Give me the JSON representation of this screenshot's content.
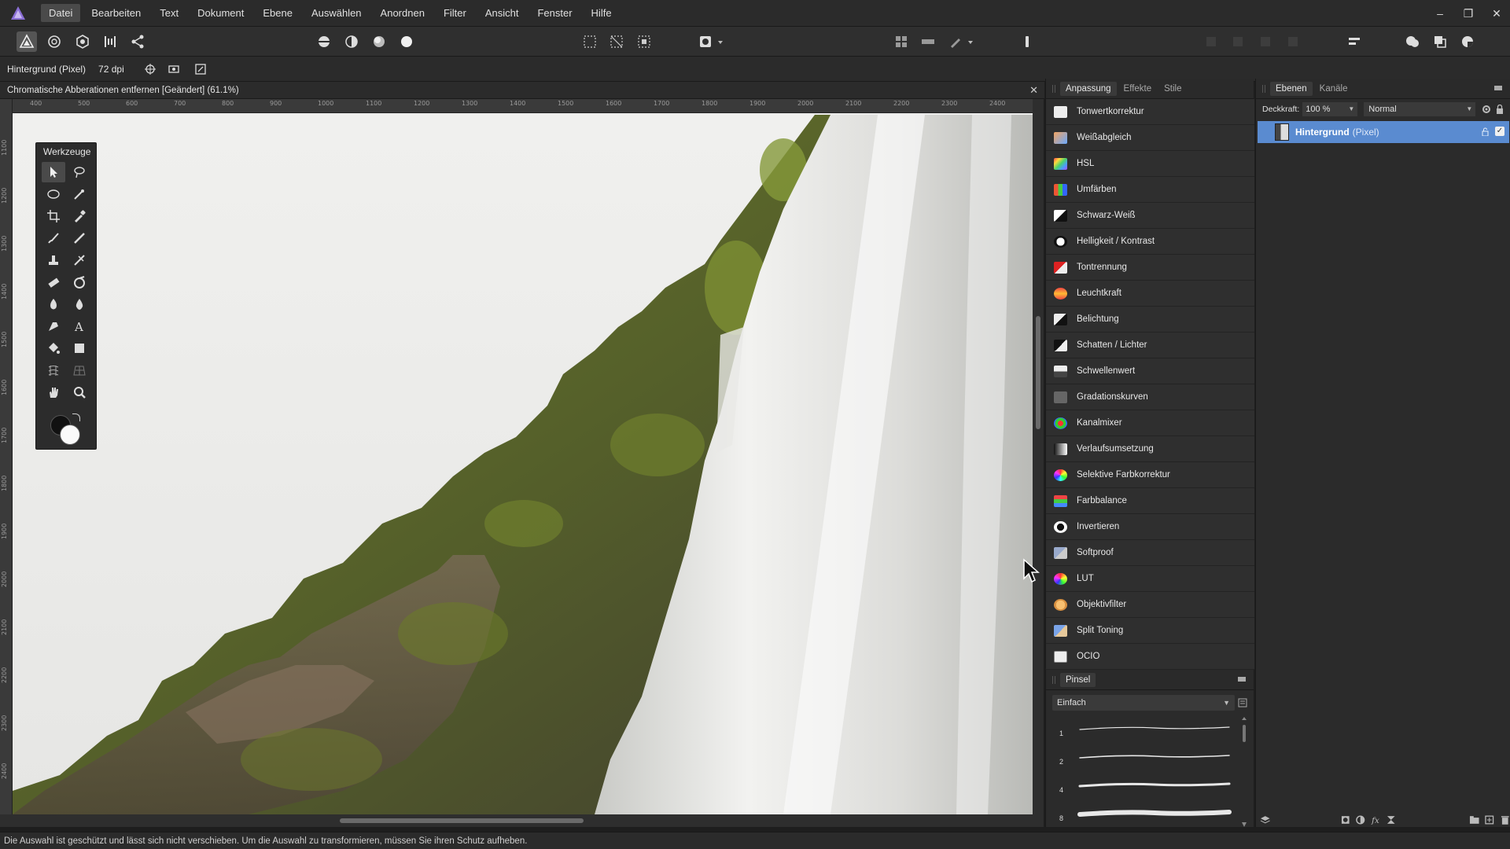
{
  "menubar": {
    "items": [
      {
        "label": "Datei",
        "active": true
      },
      {
        "label": "Bearbeiten"
      },
      {
        "label": "Text"
      },
      {
        "label": "Dokument"
      },
      {
        "label": "Ebene"
      },
      {
        "label": "Auswählen"
      },
      {
        "label": "Anordnen"
      },
      {
        "label": "Filter"
      },
      {
        "label": "Ansicht"
      },
      {
        "label": "Fenster"
      },
      {
        "label": "Hilfe"
      }
    ],
    "window_controls": [
      "minimize-icon",
      "restore-icon",
      "close-icon"
    ]
  },
  "context": {
    "layer_label": "Hintergrund (Pixel)",
    "dpi": "72 dpi"
  },
  "document": {
    "title": "Chromatische Abberationen entfernen [Geändert] (61.1%)",
    "close": "✕"
  },
  "rulers": {
    "top": [
      "400",
      "500",
      "600",
      "700",
      "800",
      "900",
      "1000",
      "1100",
      "1200",
      "1300",
      "1400",
      "1500",
      "1600",
      "1700",
      "1800",
      "1900",
      "2000",
      "2100",
      "2200",
      "2300",
      "2400"
    ],
    "left": [
      "1100",
      "1200",
      "1300",
      "1400",
      "1500",
      "1600",
      "1700",
      "1800",
      "1900",
      "2000",
      "2100",
      "2200",
      "2300",
      "2400"
    ]
  },
  "tools": {
    "title": "Werkzeuge"
  },
  "adjustments": {
    "tabs": [
      "Anpassung",
      "Effekte",
      "Stile"
    ],
    "active_tab": "Anpassung",
    "items": [
      {
        "label": "Tonwertkorrektur",
        "icon": "levels-icon"
      },
      {
        "label": "Weißabgleich",
        "icon": "white-balance-icon"
      },
      {
        "label": "HSL",
        "icon": "hsl-icon"
      },
      {
        "label": "Umfärben",
        "icon": "recolor-icon"
      },
      {
        "label": "Schwarz-Weiß",
        "icon": "black-white-icon"
      },
      {
        "label": "Helligkeit / Kontrast",
        "icon": "brightness-contrast-icon"
      },
      {
        "label": "Tontrennung",
        "icon": "posterize-icon"
      },
      {
        "label": "Leuchtkraft",
        "icon": "vibrance-icon"
      },
      {
        "label": "Belichtung",
        "icon": "exposure-icon"
      },
      {
        "label": "Schatten / Lichter",
        "icon": "shadows-highlights-icon"
      },
      {
        "label": "Schwellenwert",
        "icon": "threshold-icon"
      },
      {
        "label": "Gradationskurven",
        "icon": "curves-icon"
      },
      {
        "label": "Kanalmixer",
        "icon": "channel-mixer-icon"
      },
      {
        "label": "Verlaufsumsetzung",
        "icon": "gradient-map-icon"
      },
      {
        "label": "Selektive Farbkorrektur",
        "icon": "selective-color-icon"
      },
      {
        "label": "Farbbalance",
        "icon": "color-balance-icon"
      },
      {
        "label": "Invertieren",
        "icon": "invert-icon"
      },
      {
        "label": "Softproof",
        "icon": "soft-proof-icon"
      },
      {
        "label": "LUT",
        "icon": "lut-icon"
      },
      {
        "label": "Objektivfilter",
        "icon": "lens-filter-icon"
      },
      {
        "label": "Split Toning",
        "icon": "split-toning-icon"
      },
      {
        "label": "OCIO",
        "icon": "ocio-icon"
      }
    ]
  },
  "brushes": {
    "tab": "Pinsel",
    "category": "Einfach",
    "items": [
      {
        "size": "1"
      },
      {
        "size": "2"
      },
      {
        "size": "4"
      },
      {
        "size": "8"
      }
    ]
  },
  "layers": {
    "tabs": [
      "Ebenen",
      "Kanäle"
    ],
    "active_tab": "Ebenen",
    "opacity_label": "Deckkraft:",
    "opacity": "100 %",
    "blend_mode": "Normal",
    "rows": [
      {
        "name": "Hintergrund",
        "type": "(Pixel)",
        "visible": true
      }
    ]
  },
  "status": {
    "text": "Die Auswahl ist geschützt und lässt sich nicht verschieben. Um die Auswahl zu transformieren, müssen Sie ihren Schutz aufheben."
  },
  "colors": {
    "accent": "#5a8bd0",
    "app_logo": "#8b6fd6",
    "panel_bg": "#2b2b2b"
  }
}
